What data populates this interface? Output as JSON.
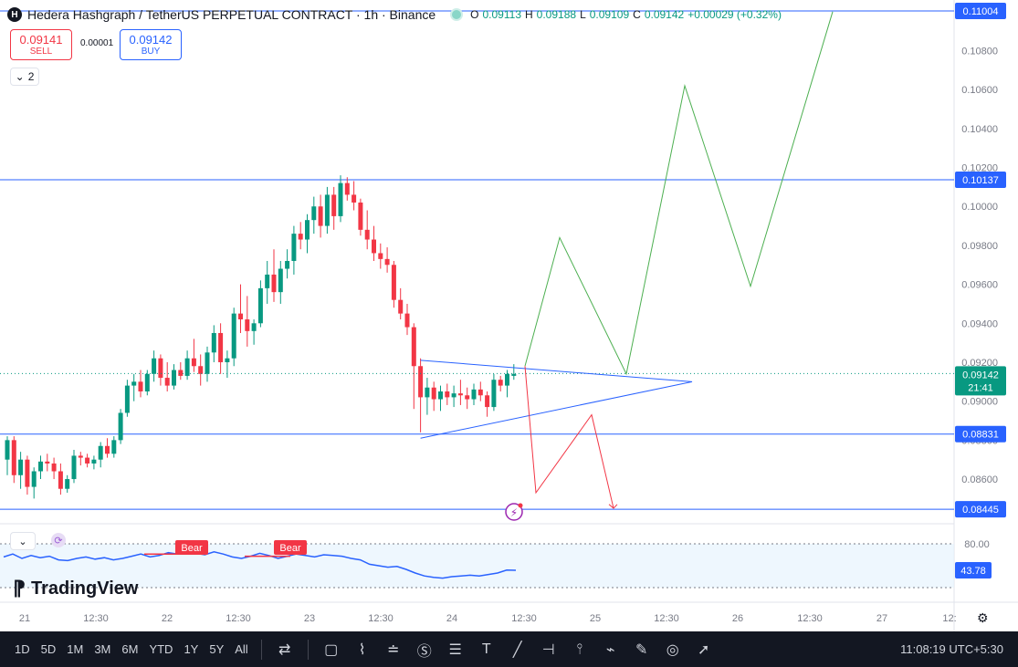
{
  "header": {
    "symbol_icon": "H",
    "title": "Hedera Hashgraph / TetherUS PERPETUAL CONTRACT · 1h · Binance",
    "o_label": "O",
    "o": "0.09113",
    "h_label": "H",
    "h": "0.09188",
    "l_label": "L",
    "l": "0.09109",
    "c_label": "C",
    "c": "0.09142",
    "change": "+0.00029 (+0.32%)"
  },
  "trade": {
    "sell_price": "0.09141",
    "sell_label": "SELL",
    "spread": "0.00001",
    "buy_price": "0.09142",
    "buy_label": "BUY"
  },
  "collapse_count": "2",
  "price_axis": {
    "ticks": [
      "0.10800",
      "0.10600",
      "0.10400",
      "0.10200",
      "0.10000",
      "0.09800",
      "0.09600",
      "0.09400",
      "0.09200",
      "0.09000",
      "0.08800",
      "0.08600"
    ],
    "tick_values": [
      0.108,
      0.106,
      0.104,
      0.102,
      0.1,
      0.098,
      0.096,
      0.094,
      0.092,
      0.09,
      0.088,
      0.086
    ],
    "ylim": [
      0.0838,
      0.1106
    ],
    "levels": [
      {
        "label": "0.11004",
        "value": 0.11004
      },
      {
        "label": "0.10137",
        "value": 0.10137
      },
      {
        "label": "0.08831",
        "value": 0.08831
      },
      {
        "label": "0.08445",
        "value": 0.08445
      }
    ],
    "last_price": "0.09142",
    "last_value": 0.09142,
    "countdown": "21:41"
  },
  "time_axis": {
    "labels": [
      "21",
      "12:30",
      "22",
      "12:30",
      "23",
      "12:30",
      "24",
      "12:30",
      "25",
      "12:30",
      "26",
      "12:30",
      "27",
      "12:"
    ]
  },
  "chart_data": {
    "type": "candlestick",
    "title": "Hedera Hashgraph / TetherUS PERPETUAL CONTRACT · 1h · Binance",
    "interval": "1h",
    "ohlc": [
      [
        0.087,
        0.0882,
        0.0862,
        0.088
      ],
      [
        0.088,
        0.0882,
        0.0858,
        0.0862
      ],
      [
        0.0862,
        0.0874,
        0.0855,
        0.087
      ],
      [
        0.087,
        0.0872,
        0.0852,
        0.0856
      ],
      [
        0.0856,
        0.0866,
        0.085,
        0.0864
      ],
      [
        0.0864,
        0.0872,
        0.086,
        0.0869
      ],
      [
        0.0869,
        0.0873,
        0.0864,
        0.0868
      ],
      [
        0.0868,
        0.0871,
        0.086,
        0.0864
      ],
      [
        0.0864,
        0.0868,
        0.0852,
        0.0855
      ],
      [
        0.0855,
        0.0862,
        0.0853,
        0.086
      ],
      [
        0.086,
        0.0875,
        0.0858,
        0.0872
      ],
      [
        0.0872,
        0.0874,
        0.0867,
        0.0871
      ],
      [
        0.0871,
        0.0873,
        0.0866,
        0.0868
      ],
      [
        0.0868,
        0.0872,
        0.0865,
        0.087
      ],
      [
        0.087,
        0.0879,
        0.0866,
        0.0877
      ],
      [
        0.0877,
        0.0881,
        0.0871,
        0.0873
      ],
      [
        0.0873,
        0.0882,
        0.0871,
        0.088
      ],
      [
        0.088,
        0.0896,
        0.0878,
        0.0894
      ],
      [
        0.0894,
        0.0911,
        0.0892,
        0.0908
      ],
      [
        0.0908,
        0.0914,
        0.09,
        0.091
      ],
      [
        0.091,
        0.0916,
        0.0902,
        0.0905
      ],
      [
        0.0905,
        0.0916,
        0.0903,
        0.0914
      ],
      [
        0.0914,
        0.0926,
        0.091,
        0.0922
      ],
      [
        0.0922,
        0.0924,
        0.0908,
        0.0912
      ],
      [
        0.0912,
        0.092,
        0.0905,
        0.0908
      ],
      [
        0.0908,
        0.0919,
        0.0906,
        0.0916
      ],
      [
        0.0916,
        0.092,
        0.0911,
        0.0913
      ],
      [
        0.0913,
        0.0926,
        0.0911,
        0.0922
      ],
      [
        0.0922,
        0.0932,
        0.0915,
        0.0918
      ],
      [
        0.0918,
        0.0924,
        0.0908,
        0.0914
      ],
      [
        0.0914,
        0.0928,
        0.091,
        0.0925
      ],
      [
        0.0925,
        0.0939,
        0.092,
        0.0935
      ],
      [
        0.0935,
        0.094,
        0.0914,
        0.092
      ],
      [
        0.092,
        0.0926,
        0.0912,
        0.0922
      ],
      [
        0.0922,
        0.0948,
        0.0918,
        0.0945
      ],
      [
        0.0945,
        0.096,
        0.0935,
        0.0942
      ],
      [
        0.0942,
        0.0954,
        0.0928,
        0.0936
      ],
      [
        0.0936,
        0.0942,
        0.0929,
        0.094
      ],
      [
        0.094,
        0.0962,
        0.0938,
        0.0958
      ],
      [
        0.0958,
        0.0972,
        0.095,
        0.0965
      ],
      [
        0.0965,
        0.0978,
        0.0951,
        0.0956
      ],
      [
        0.0956,
        0.0972,
        0.095,
        0.0968
      ],
      [
        0.0968,
        0.0978,
        0.0963,
        0.0972
      ],
      [
        0.0972,
        0.099,
        0.0965,
        0.0986
      ],
      [
        0.0986,
        0.0992,
        0.0978,
        0.0983
      ],
      [
        0.0983,
        0.0996,
        0.0976,
        0.0993
      ],
      [
        0.0993,
        0.1005,
        0.0986,
        0.1
      ],
      [
        0.1,
        0.1006,
        0.0984,
        0.099
      ],
      [
        0.099,
        0.101,
        0.0986,
        0.1006
      ],
      [
        0.1006,
        0.101,
        0.0988,
        0.0995
      ],
      [
        0.0995,
        0.1016,
        0.0992,
        0.1012
      ],
      [
        0.1012,
        0.1015,
        0.1003,
        0.1006
      ],
      [
        0.1006,
        0.1013,
        0.0998,
        0.1002
      ],
      [
        0.1002,
        0.1004,
        0.0985,
        0.0988
      ],
      [
        0.0988,
        0.0998,
        0.0978,
        0.0983
      ],
      [
        0.0983,
        0.099,
        0.0972,
        0.0976
      ],
      [
        0.0976,
        0.0981,
        0.0968,
        0.0973
      ],
      [
        0.0973,
        0.0979,
        0.0966,
        0.097
      ],
      [
        0.097,
        0.0972,
        0.0948,
        0.0952
      ],
      [
        0.0952,
        0.0958,
        0.0942,
        0.0945
      ],
      [
        0.0945,
        0.095,
        0.0934,
        0.0938
      ],
      [
        0.0938,
        0.094,
        0.0896,
        0.0918
      ],
      [
        0.0918,
        0.0922,
        0.0884,
        0.0902
      ],
      [
        0.0902,
        0.0912,
        0.0893,
        0.0907
      ],
      [
        0.0907,
        0.091,
        0.0895,
        0.0901
      ],
      [
        0.0901,
        0.0908,
        0.0895,
        0.0905
      ],
      [
        0.0905,
        0.0909,
        0.0898,
        0.0902
      ],
      [
        0.0902,
        0.0908,
        0.0897,
        0.0904
      ],
      [
        0.0904,
        0.0911,
        0.0898,
        0.0903
      ],
      [
        0.0903,
        0.0907,
        0.0896,
        0.0901
      ],
      [
        0.0901,
        0.0909,
        0.0898,
        0.0906
      ],
      [
        0.0906,
        0.091,
        0.09,
        0.0903
      ],
      [
        0.0903,
        0.0905,
        0.0892,
        0.0897
      ],
      [
        0.0897,
        0.0914,
        0.0895,
        0.0911
      ],
      [
        0.0911,
        0.0913,
        0.0905,
        0.0908
      ],
      [
        0.0908,
        0.0916,
        0.0902,
        0.0914
      ],
      [
        0.0913,
        0.0919,
        0.0911,
        0.0914
      ]
    ],
    "drawings": {
      "triangle_pattern": [
        [
          0.0921
        ],
        [
          0.0881
        ],
        [
          0.091
        ]
      ],
      "bullish_projection_prices": [
        0.0918,
        0.0984,
        0.0914,
        0.1062,
        0.0959,
        0.11
      ],
      "bearish_projection_prices": [
        0.0918,
        0.0853,
        0.0893,
        0.0845
      ]
    },
    "indicator": {
      "upper_band_label": "80.00",
      "current_label": "43.78",
      "current": 43.78,
      "upper_band": 80.0,
      "lower_band": 20.0,
      "values": [
        62,
        66,
        60,
        64,
        61,
        63,
        58,
        57,
        60,
        62,
        59,
        61,
        58,
        60,
        63,
        66,
        62,
        64,
        68,
        66,
        70,
        67,
        65,
        69,
        66,
        62,
        60,
        63,
        67,
        64,
        60,
        63,
        66,
        64,
        62,
        65,
        64,
        63,
        60,
        58,
        52,
        50,
        48,
        49,
        45,
        40,
        36,
        34,
        33,
        35,
        36,
        37,
        36,
        38,
        40,
        44,
        43.78
      ],
      "labels": [
        "Bear",
        "Bear"
      ]
    }
  },
  "toolbar": {
    "timeframes": [
      "1D",
      "5D",
      "1M",
      "3M",
      "6M",
      "YTD",
      "1Y",
      "5Y",
      "All"
    ],
    "clock": "11:08:19 UTC+5:30"
  },
  "brand": "TradingView",
  "colors": {
    "up": "#089981",
    "down": "#f23645",
    "accent": "#2962ff",
    "bull_line": "#4caf50",
    "bear_line": "#f23645"
  }
}
